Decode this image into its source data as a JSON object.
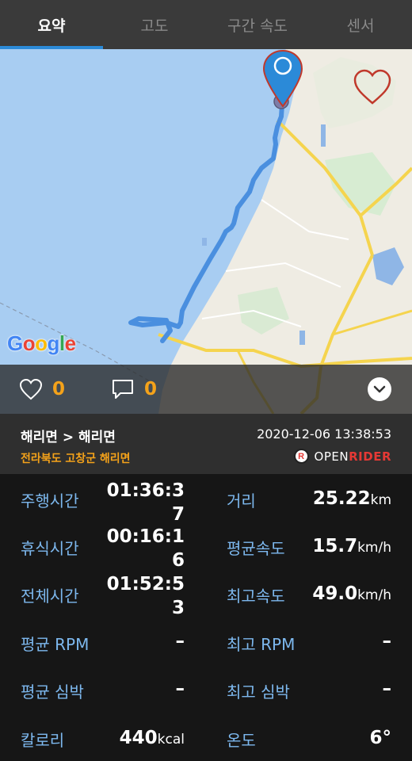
{
  "tabs": [
    {
      "label": "요약",
      "active": true
    },
    {
      "label": "고도",
      "active": false
    },
    {
      "label": "구간 속도",
      "active": false
    },
    {
      "label": "센서",
      "active": false
    }
  ],
  "map": {
    "provider_logo": "Google",
    "route_color": "#4a8fdf",
    "marker_icon": "location-pin-icon",
    "favorite_icon": "heart-outline-icon"
  },
  "social": {
    "likes": "0",
    "comments": "0"
  },
  "ride": {
    "title": "해리면 > 해리면",
    "datetime": "2020-12-06 13:38:53",
    "location": "전라북도 고창군 해리면",
    "brand_open": "OPEN",
    "brand_rider": "RIDER"
  },
  "stats": {
    "ride_time_label": "주행시간",
    "ride_time": "01:36:37",
    "distance_label": "거리",
    "distance": "25.22",
    "distance_unit": "km",
    "rest_time_label": "휴식시간",
    "rest_time": "00:16:16",
    "avg_speed_label": "평균속도",
    "avg_speed": "15.7",
    "avg_speed_unit": "km/h",
    "total_time_label": "전체시간",
    "total_time": "01:52:53",
    "max_speed_label": "최고속도",
    "max_speed": "49.0",
    "max_speed_unit": "km/h",
    "avg_rpm_label": "평균 RPM",
    "avg_rpm": "–",
    "max_rpm_label": "최고 RPM",
    "max_rpm": "–",
    "avg_hr_label": "평균 심박",
    "avg_hr": "–",
    "max_hr_label": "최고 심박",
    "max_hr": "–",
    "calories_label": "칼로리",
    "calories": "440",
    "calories_unit": "kcal",
    "temp_label": "온도",
    "temp": "6°"
  },
  "colors": {
    "accent_blue": "#2b8ad8",
    "label_blue": "#7db8ee",
    "orange": "#f4a21a",
    "brand_red": "#e53935"
  }
}
